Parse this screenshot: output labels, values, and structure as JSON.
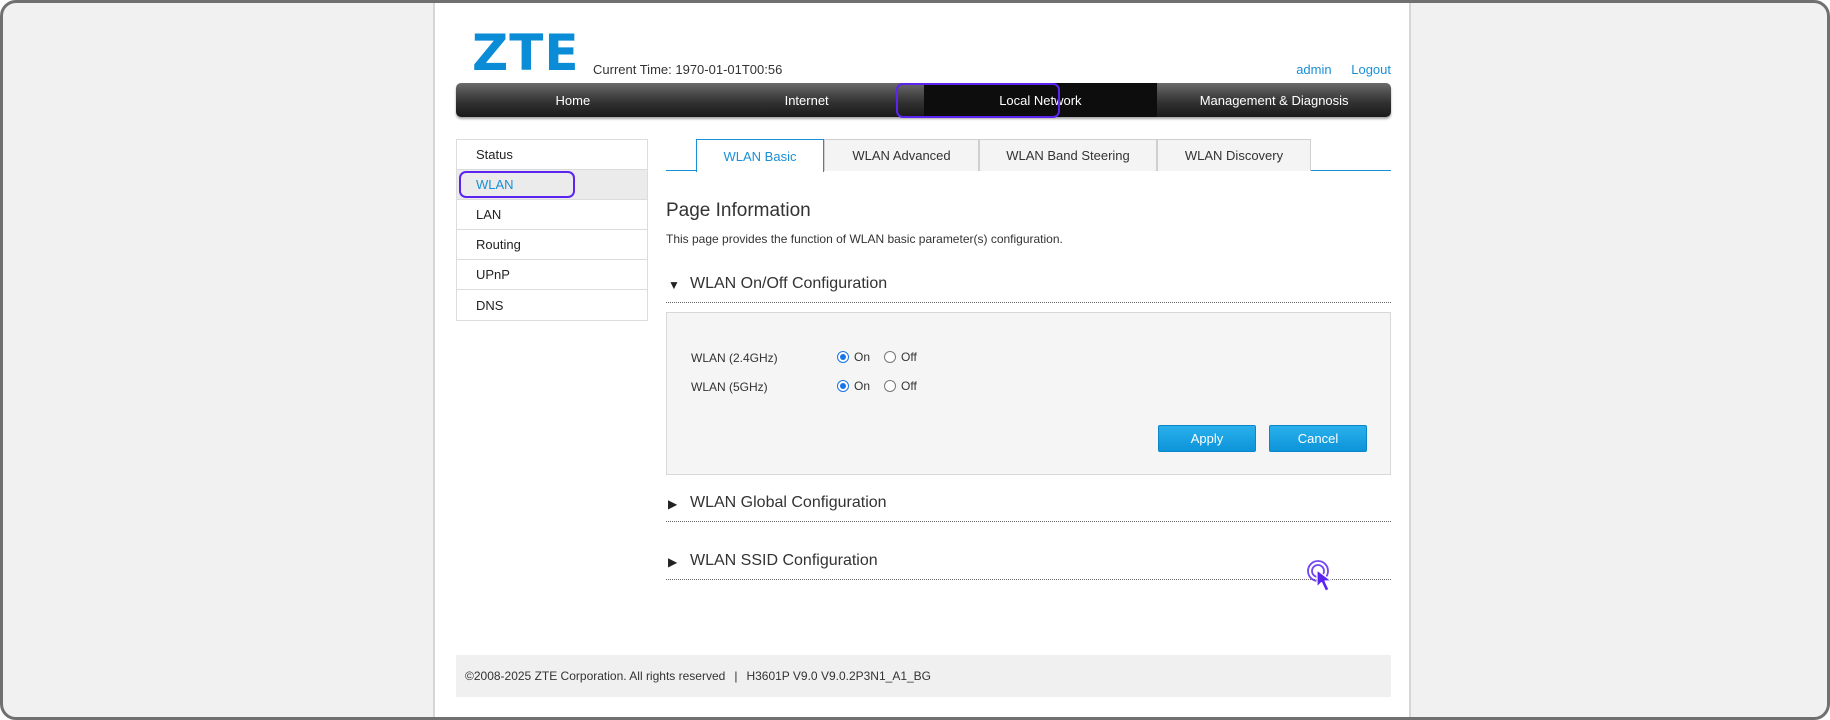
{
  "header": {
    "logo": "ZTE",
    "current_time": "Current Time: 1970-01-01T00:56",
    "user": "admin",
    "logout": "Logout"
  },
  "nav": {
    "items": [
      "Home",
      "Internet",
      "Local Network",
      "Management & Diagnosis"
    ],
    "active": "Local Network"
  },
  "sidebar": {
    "items": [
      "Status",
      "WLAN",
      "LAN",
      "Routing",
      "UPnP",
      "DNS"
    ],
    "active": "WLAN"
  },
  "tabs": {
    "items": [
      "WLAN Basic",
      "WLAN Advanced",
      "WLAN Band Steering",
      "WLAN Discovery"
    ],
    "active": "WLAN Basic"
  },
  "page_info": {
    "title": "Page Information",
    "description": "This page provides the function of WLAN basic parameter(s) configuration."
  },
  "sections": {
    "onoff": {
      "title": "WLAN On/Off Configuration",
      "expanded": true
    },
    "global": {
      "title": "WLAN Global Configuration",
      "expanded": false
    },
    "ssid": {
      "title": "WLAN SSID Configuration",
      "expanded": false
    }
  },
  "onoff_config": {
    "rows": [
      {
        "label": "WLAN (2.4GHz)",
        "on": "On",
        "off": "Off",
        "selected": "On"
      },
      {
        "label": "WLAN (5GHz)",
        "on": "On",
        "off": "Off",
        "selected": "On"
      }
    ],
    "apply": "Apply",
    "cancel": "Cancel"
  },
  "footer": {
    "copyright": "©2008-2025 ZTE Corporation. All rights reserved",
    "separator": "|",
    "version": "H3601P V9.0 V9.0.2P3N1_A1_BG"
  },
  "colors": {
    "brand": "#0a8cd6",
    "accent": "#1a8fd6",
    "highlight": "#5b24f0",
    "button": "#1a9fe0"
  },
  "icons": {
    "expanded": "triangle-down-icon",
    "collapsed": "triangle-right-icon",
    "pointer": "mouse-cursor-icon"
  }
}
